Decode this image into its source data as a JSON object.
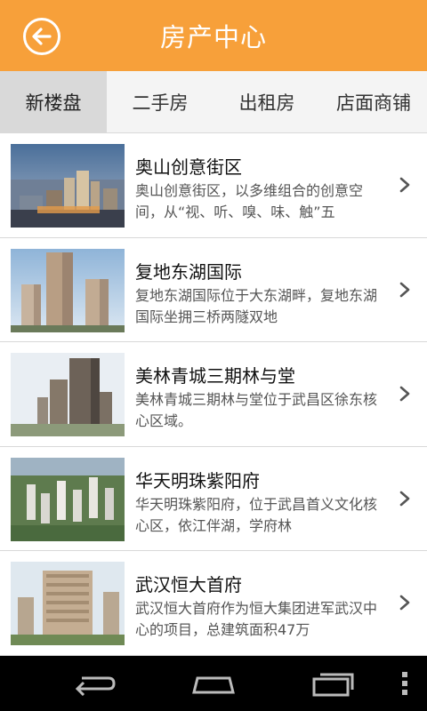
{
  "header": {
    "title": "房产中心",
    "back_icon": "back-arrow-icon",
    "background": "#f7a03a"
  },
  "tabs": [
    {
      "label": "新楼盘",
      "active": true
    },
    {
      "label": "二手房",
      "active": false
    },
    {
      "label": "出租房",
      "active": false
    },
    {
      "label": "店面商铺",
      "active": false
    }
  ],
  "listings": [
    {
      "title": "奥山创意街区",
      "description": "奥山创意街区，以多维组合的创意空间，从“视、听、嗅、味、触”五"
    },
    {
      "title": "复地东湖国际",
      "description": "复地东湖国际位于大东湖畔，复地东湖国际坐拥三桥两隧双地"
    },
    {
      "title": "美林青城三期林与堂",
      "description": "美林青城三期林与堂位于武昌区徐东核心区域。"
    },
    {
      "title": "华天明珠紫阳府",
      "description": "华天明珠紫阳府，位于武昌首义文化核心区，依江伴湖，学府林"
    },
    {
      "title": "武汉恒大首府",
      "description": "武汉恒大首府作为恒大集团进军武汉中心的项目，总建筑面积47万"
    }
  ],
  "navbar": {
    "back_icon": "nav-back-icon",
    "home_icon": "nav-home-icon",
    "recent_icon": "nav-recent-apps-icon",
    "menu_icon": "overflow-menu-icon"
  }
}
